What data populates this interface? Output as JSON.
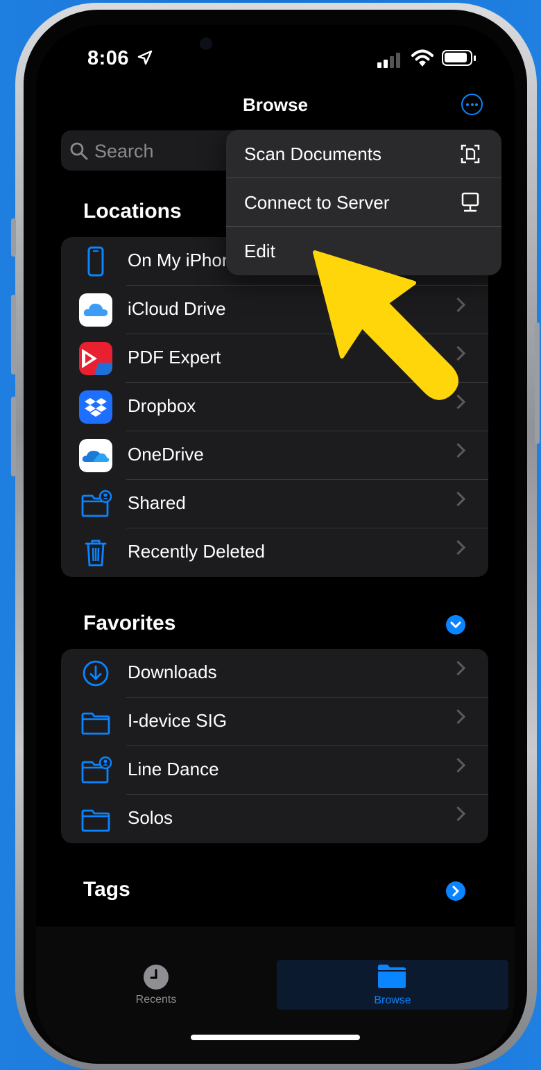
{
  "status_bar": {
    "time": "8:06"
  },
  "header": {
    "title": "Browse"
  },
  "search": {
    "placeholder": "Search"
  },
  "menu": {
    "items": [
      {
        "label": "Scan Documents",
        "icon": "scan-document-icon"
      },
      {
        "label": "Connect to Server",
        "icon": "server-icon"
      },
      {
        "label": "Edit"
      }
    ]
  },
  "locations": {
    "heading": "Locations",
    "items": [
      {
        "label": "On My iPhone",
        "icon": "iphone-icon"
      },
      {
        "label": "iCloud Drive",
        "icon": "icloud-icon"
      },
      {
        "label": "PDF Expert",
        "icon": "pdf-expert-icon"
      },
      {
        "label": "Dropbox",
        "icon": "dropbox-icon"
      },
      {
        "label": "OneDrive",
        "icon": "onedrive-icon"
      },
      {
        "label": "Shared",
        "icon": "shared-folder-icon"
      },
      {
        "label": "Recently Deleted",
        "icon": "trash-icon"
      }
    ]
  },
  "favorites": {
    "heading": "Favorites",
    "items": [
      {
        "label": "Downloads",
        "icon": "download-icon"
      },
      {
        "label": "I-device SIG",
        "icon": "folder-icon"
      },
      {
        "label": "Line Dance",
        "icon": "shared-folder-icon"
      },
      {
        "label": "Solos",
        "icon": "folder-icon"
      }
    ]
  },
  "tags": {
    "heading": "Tags"
  },
  "tabbar": {
    "tabs": [
      {
        "label": "Recents",
        "icon": "clock-icon",
        "selected": false
      },
      {
        "label": "Browse",
        "icon": "folder-fill-icon",
        "selected": true
      }
    ]
  },
  "colors": {
    "accent": "#0a84ff",
    "annotation_arrow": "#ffd60a",
    "background": "#1b7ad9"
  }
}
